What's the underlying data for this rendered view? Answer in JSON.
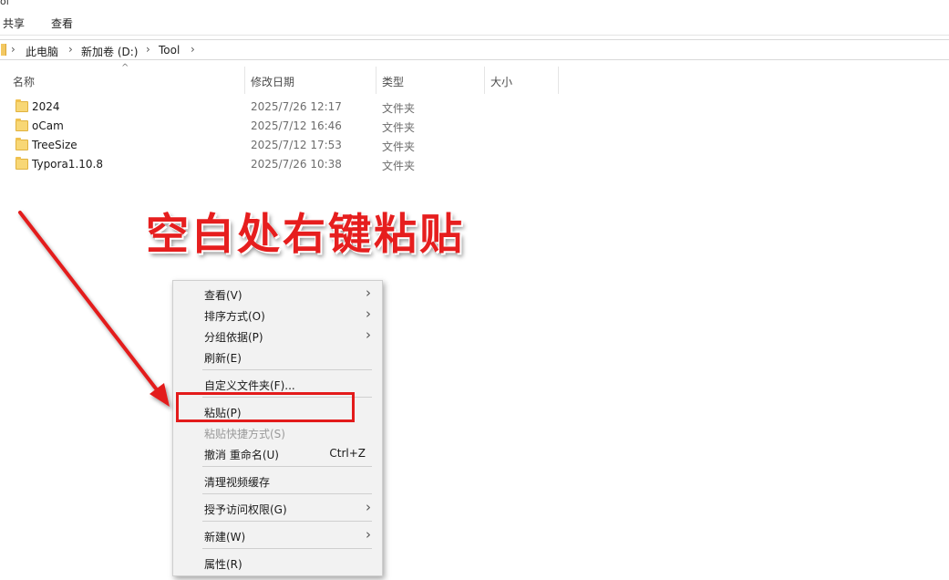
{
  "window": {
    "title_fragment": "ol"
  },
  "ribbon": {
    "tabs": [
      "共享",
      "查看"
    ]
  },
  "address_bar": {
    "crumbs": [
      "此电脑",
      "新加卷 (D:)",
      "Tool"
    ]
  },
  "columns": {
    "name": "名称",
    "date": "修改日期",
    "type": "类型",
    "size": "大小"
  },
  "files": [
    {
      "name": "2024",
      "date": "2025/7/26 12:17",
      "type": "文件夹"
    },
    {
      "name": "oCam",
      "date": "2025/7/12 16:46",
      "type": "文件夹"
    },
    {
      "name": "TreeSize",
      "date": "2025/7/12 17:53",
      "type": "文件夹"
    },
    {
      "name": "Typora1.10.8",
      "date": "2025/7/26 10:38",
      "type": "文件夹"
    }
  ],
  "annotation": {
    "text": "空白处右键粘贴",
    "color": "#e61e1e"
  },
  "context_menu": {
    "view": "查看(V)",
    "sort": "排序方式(O)",
    "group": "分组依据(P)",
    "refresh": "刷新(E)",
    "customize": "自定义文件夹(F)...",
    "paste": "粘贴(P)",
    "paste_shortcut": "粘贴快捷方式(S)",
    "undo": "撤消 重命名(U)",
    "undo_shortcut": "Ctrl+Z",
    "clear_cache": "清理视频缓存",
    "grant_access": "授予访问权限(G)",
    "new": "新建(W)",
    "properties": "属性(R)"
  },
  "icons": {
    "folder": "folder-icon",
    "submenu": "chevron-right-icon",
    "breadcrumb_separator": "chevron-right-icon",
    "sort_indicator": "caret-up-icon"
  }
}
